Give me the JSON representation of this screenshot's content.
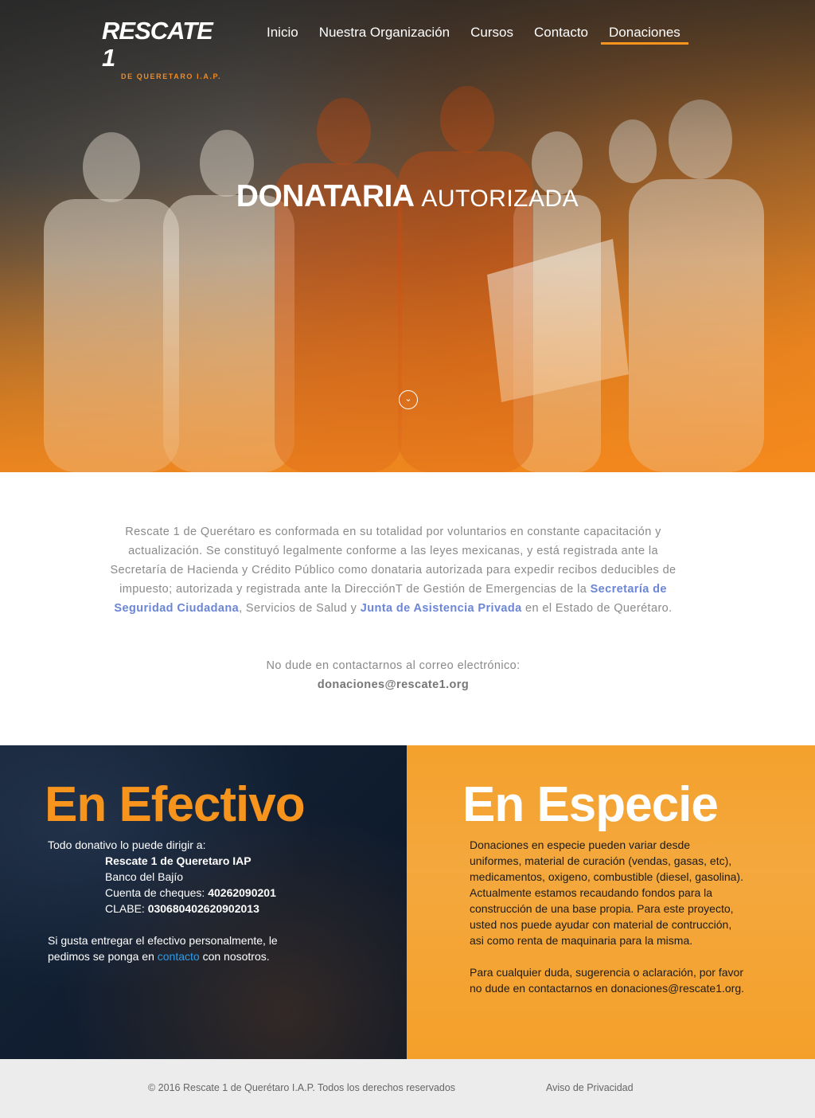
{
  "header": {
    "logo_main": "RESCATE 1",
    "logo_sub": "DE QUERETARO I.A.P.",
    "nav": [
      {
        "label": "Inicio"
      },
      {
        "label": "Nuestra Organización"
      },
      {
        "label": "Cursos"
      },
      {
        "label": "Contacto"
      },
      {
        "label": "Donaciones",
        "active": true
      }
    ]
  },
  "hero": {
    "title_bold": "DONATARIA",
    "title_light": "AUTORIZADA",
    "scroll_icon": "chevron-down-icon"
  },
  "intro": {
    "p1_a": "Rescate 1 de Querétaro es conformada en su totalidad por voluntarios en constante capacitación y actualización. Se constituyó legalmente conforme a las leyes mexicanas, y está registrada ante la Secretaría de Hacienda y Crédito Público como donataria autorizada para expedir recibos deducibles de impuesto; autorizada y registrada ante la DirecciónT de Gestión de Emergencias de la ",
    "link_ssc": "Secretaría de Seguridad Ciudadana",
    "p1_b": ", Servicios de Salud y ",
    "link_jap": "Junta de Asistencia Privada",
    "p1_c": " en el Estado de Querétaro.",
    "p2": "No dude en contactarnos al correo electrónico:",
    "email": "donaciones@rescate1.org"
  },
  "efectivo": {
    "title": "En Efectivo",
    "intro": "Todo donativo lo puede dirigir a:",
    "account_name": "Rescate 1 de Queretaro IAP",
    "bank": "Banco del Bajío",
    "cheques_label": "Cuenta de cheques: ",
    "cheques_value": "40262090201",
    "clabe_label": "CLABE: ",
    "clabe_value": "030680402620902013",
    "personal_a": "Si gusta entregar el efectivo personalmente, le pedimos se ponga en ",
    "personal_link": "contacto",
    "personal_b": " con nosotros."
  },
  "especie": {
    "title": "En Especie",
    "p1": "Donaciones en especie pueden variar desde uniformes, material de curación (vendas, gasas, etc), medicamentos, oxigeno, combustible (diesel, gasolina). Actualmente estamos recaudando fondos para la construcción de una base propia. Para este proyecto, usted nos puede ayudar con material de contrucción, asi como renta de maquinaria para la misma.",
    "p2": "Para cualquier duda, sugerencia o aclaración, por favor no dude en contactarnos en donaciones@rescate1.org."
  },
  "footer": {
    "copyright": "© 2016 Rescate 1 de Querétaro I.A.P. Todos los derechos reservados",
    "privacy": "Aviso de Privacidad"
  },
  "colors": {
    "accent_orange": "#f7941d",
    "navy": "#0f1c2e",
    "link_blue": "#6b86d6"
  }
}
